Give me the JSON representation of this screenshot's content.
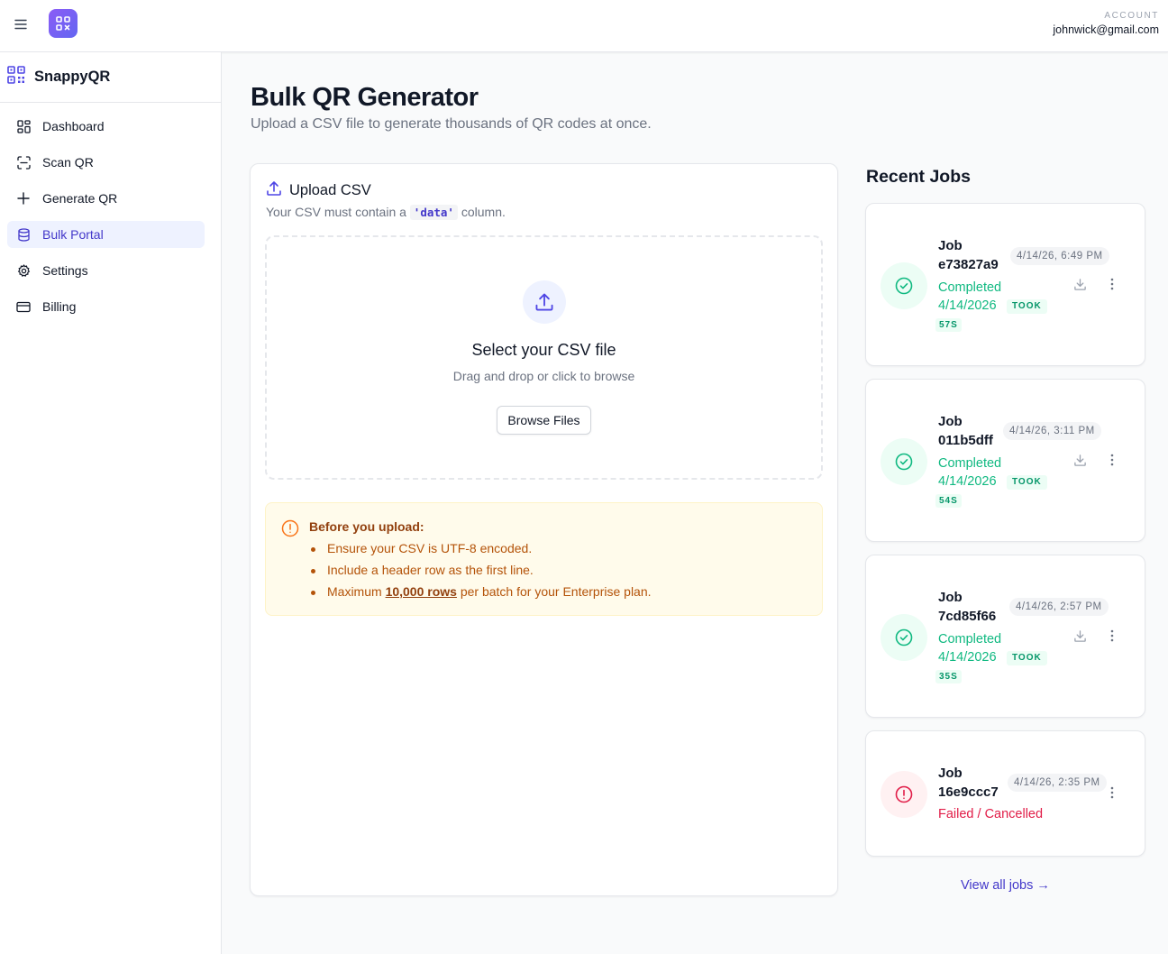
{
  "header": {
    "menu_icon": "hamburger-icon",
    "app_icon": "qr-grid-icon",
    "account_label": "ACCOUNT",
    "account_email": "johnwick@gmail.com"
  },
  "sidebar": {
    "brand": "SnappyQR",
    "brand_icon": "qr-code-icon",
    "items": [
      {
        "label": "Dashboard",
        "icon": "dashboard-icon",
        "active": false
      },
      {
        "label": "Scan QR",
        "icon": "scan-icon",
        "active": false
      },
      {
        "label": "Generate QR",
        "icon": "plus-icon",
        "active": false
      },
      {
        "label": "Bulk Portal",
        "icon": "database-icon",
        "active": true
      },
      {
        "label": "Settings",
        "icon": "gear-icon",
        "active": false
      },
      {
        "label": "Billing",
        "icon": "credit-card-icon",
        "active": false
      }
    ]
  },
  "page": {
    "title": "Bulk QR Generator",
    "subtitle": "Upload a CSV file to generate thousands of QR codes at once."
  },
  "upload": {
    "title": "Upload CSV",
    "desc_before": "Your CSV must contain a ",
    "desc_code": "'data'",
    "desc_after": " column.",
    "dropzone_title": "Select your CSV file",
    "dropzone_sub": "Drag and drop or click to browse",
    "browse_label": "Browse Files"
  },
  "notice": {
    "title": "Before you upload:",
    "item1": "Ensure your CSV is UTF-8 encoded.",
    "item2": "Include a header row as the first line.",
    "item3_before": "Maximum ",
    "item3_link": "10,000 rows",
    "item3_after": " per batch for your Enterprise plan."
  },
  "recent_jobs": {
    "title": "Recent Jobs",
    "view_all": "View all jobs →",
    "jobs": [
      {
        "label": "Job",
        "id": "e73827a9",
        "date": "4/14/26, 6:49 PM",
        "status": "Completed",
        "finished": "4/14/2026",
        "took_label": "TOOK",
        "took": "57S"
      },
      {
        "label": "Job",
        "id": "011b5dff",
        "date": "4/14/26, 3:11 PM",
        "status": "Completed",
        "finished": "4/14/2026",
        "took_label": "TOOK",
        "took": "54S"
      },
      {
        "label": "Job",
        "id": "7cd85f66",
        "date": "4/14/26, 2:57 PM",
        "status": "Completed",
        "finished": "4/14/2026",
        "took_label": "TOOK",
        "took": "35S"
      },
      {
        "label": "Job",
        "id": "16e9ccc7",
        "date": "4/14/26, 2:35 PM",
        "status": "Failed / Cancelled"
      }
    ]
  },
  "colors": {
    "accent": "#4338ca",
    "success": "#10b981",
    "danger": "#e11d48",
    "warning_bg": "#fffbeb"
  }
}
